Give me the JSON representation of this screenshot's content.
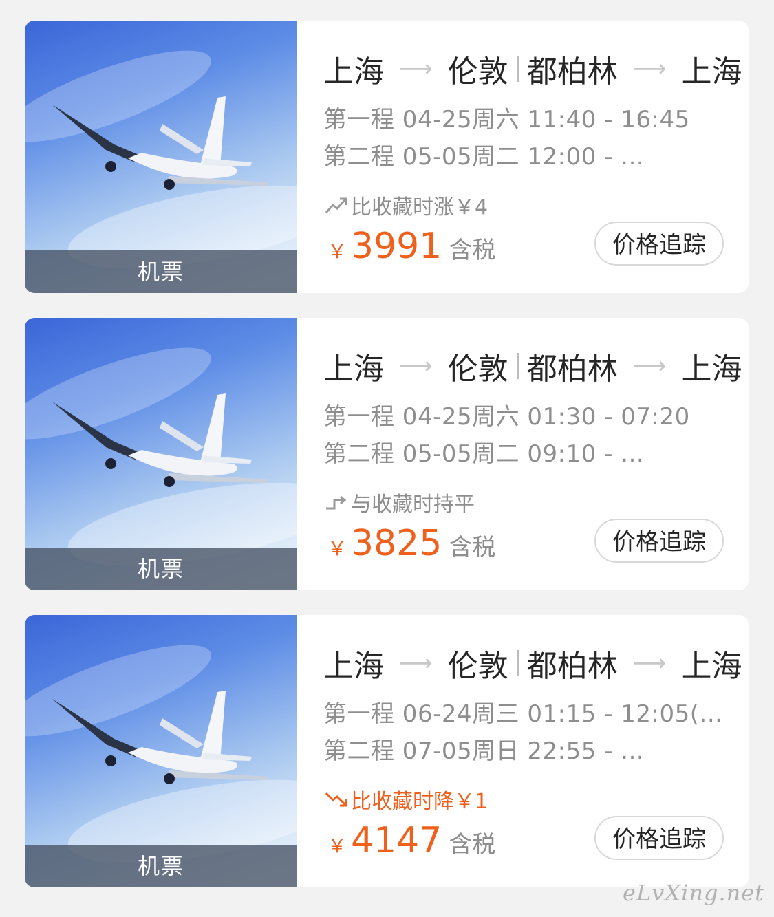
{
  "colors": {
    "accent": "#f0601d",
    "muted": "#8e8e8e",
    "text": "#262626"
  },
  "cards": [
    {
      "thumb_label": "机票",
      "route": {
        "from": "上海",
        "to": "伦敦",
        "return_from": "都柏林",
        "return_to": "上海"
      },
      "leg1": "第一程 04-25周六 11:40 - 16:45",
      "leg2": "第二程 05-05周二 12:00 - ...",
      "trend": {
        "icon": "trend-up-icon",
        "text": "比收藏时涨￥4",
        "type": "up"
      },
      "price": {
        "currency": "￥",
        "amount": "3991",
        "tax_note": "含税"
      },
      "track_label": "价格追踪"
    },
    {
      "thumb_label": "机票",
      "route": {
        "from": "上海",
        "to": "伦敦",
        "return_from": "都柏林",
        "return_to": "上海"
      },
      "leg1": "第一程 04-25周六 01:30 - 07:20",
      "leg2": "第二程 05-05周二 09:10 - ...",
      "trend": {
        "icon": "trend-flat-icon",
        "text": "与收藏时持平",
        "type": "flat"
      },
      "price": {
        "currency": "￥",
        "amount": "3825",
        "tax_note": "含税"
      },
      "track_label": "价格追踪"
    },
    {
      "thumb_label": "机票",
      "route": {
        "from": "上海",
        "to": "伦敦",
        "return_from": "都柏林",
        "return_to": "上海"
      },
      "leg1": "第一程 06-24周三 01:15 - 12:05(...",
      "leg2": "第二程 07-05周日 22:55 - ...",
      "trend": {
        "icon": "trend-down-icon",
        "text": "比收藏时降￥1",
        "type": "down"
      },
      "price": {
        "currency": "￥",
        "amount": "4147",
        "tax_note": "含税"
      },
      "track_label": "价格追踪"
    }
  ],
  "watermark": "eLvXing.net"
}
